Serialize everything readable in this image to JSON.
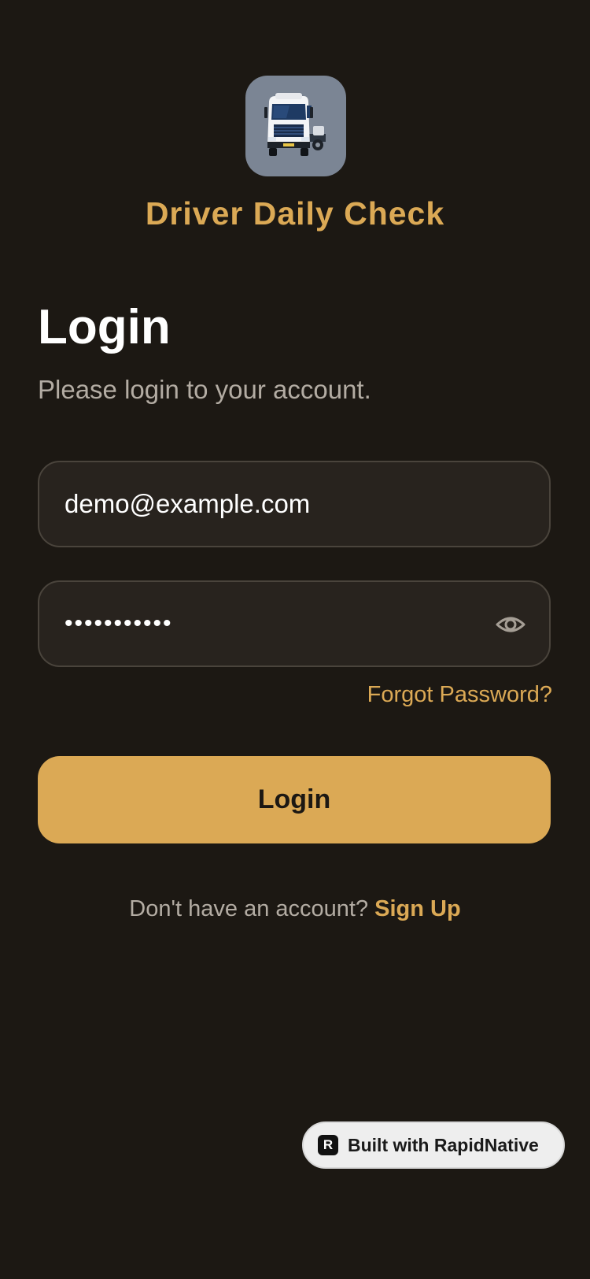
{
  "app": {
    "name": "Driver Daily Check",
    "logo_icon": "truck-icon"
  },
  "login": {
    "title": "Login",
    "subtitle": "Please login to your account.",
    "email_value": "demo@example.com",
    "password_value": "•••••••••••",
    "forgot_label": "Forgot Password?",
    "button_label": "Login"
  },
  "signup": {
    "prompt": "Don't have an account?",
    "link_label": "Sign Up"
  },
  "badge": {
    "label": "Built with RapidNative",
    "icon": "R"
  },
  "colors": {
    "background": "#1c1813",
    "accent": "#dba955",
    "field_bg": "#28231e",
    "muted_text": "#b3aca3"
  }
}
